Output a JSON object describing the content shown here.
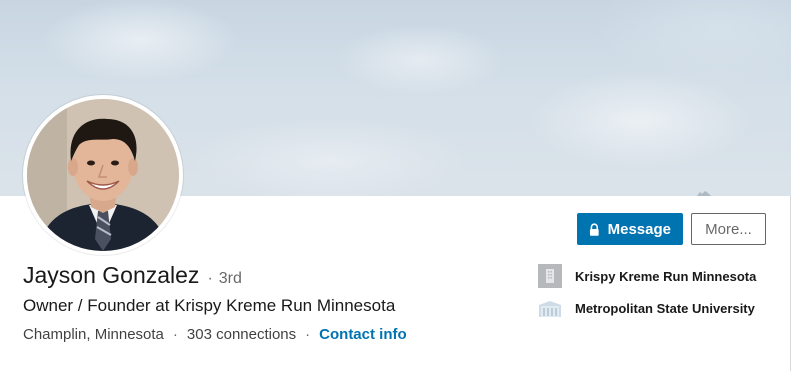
{
  "profile": {
    "name": "Jayson Gonzalez",
    "degree_separator": "·",
    "degree": "3rd",
    "headline": "Owner / Founder at Krispy Kreme Run Minnesota",
    "location": "Champlin, Minnesota",
    "connections": "303 connections",
    "contact_info": "Contact info",
    "meta_separator": "·"
  },
  "actions": {
    "message_label": "Message",
    "more_label": "More..."
  },
  "organizations": [
    {
      "name": "Krispy Kreme Run Minnesota",
      "icon": "company-building-icon"
    },
    {
      "name": "Metropolitan State University",
      "icon": "school-icon"
    }
  ],
  "colors": {
    "accent": "#0073b1",
    "cover_sky": "#d4dfe8"
  }
}
